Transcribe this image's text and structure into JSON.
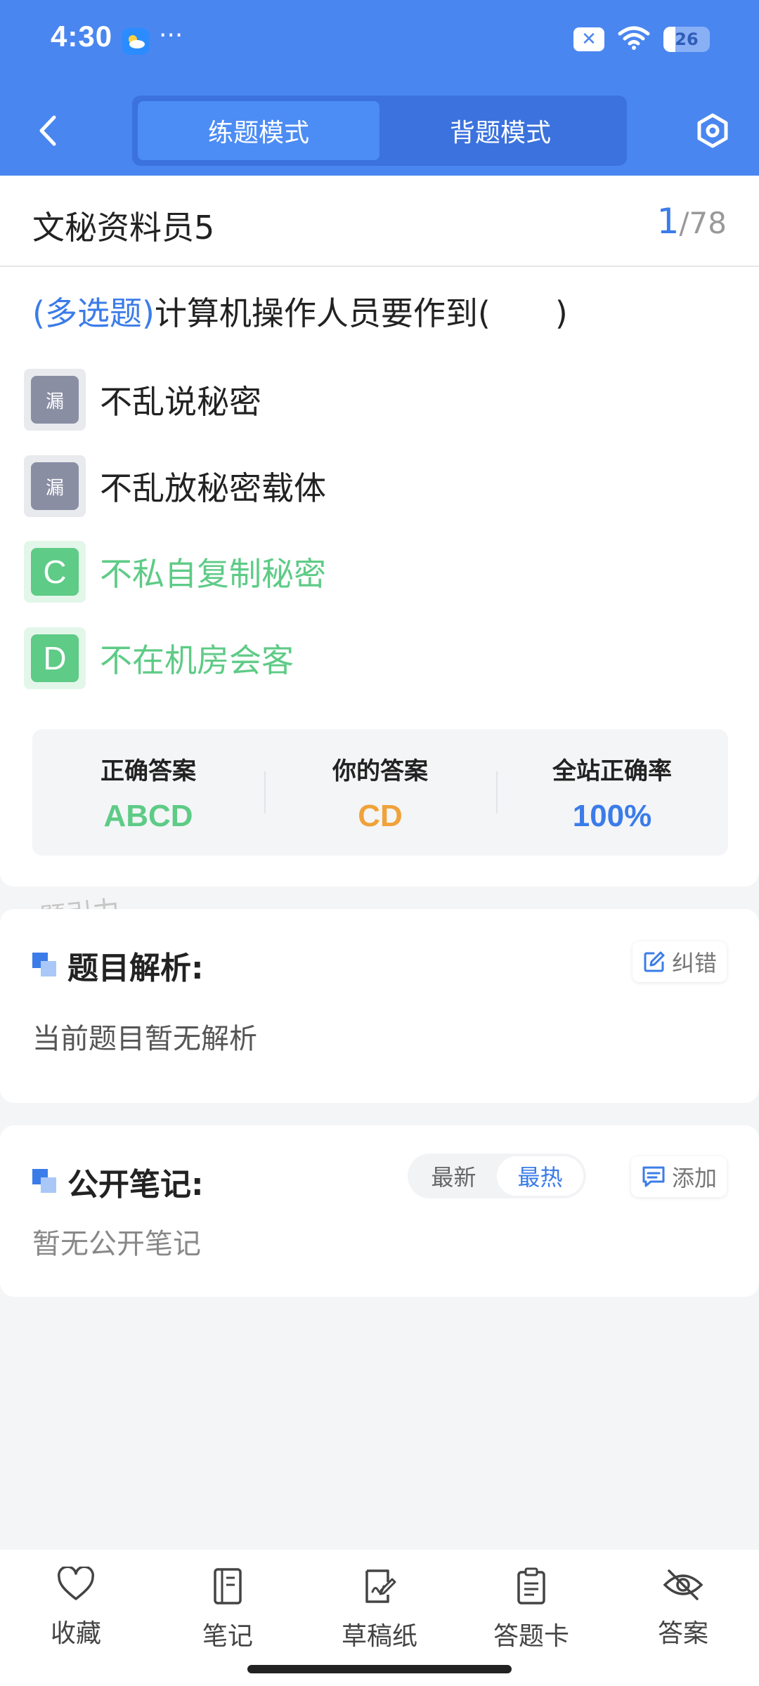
{
  "status": {
    "time": "4:30",
    "dots": "···",
    "battery": "26"
  },
  "nav": {
    "modes": [
      {
        "label": "练题模式",
        "active": true
      },
      {
        "label": "背题模式",
        "active": false
      }
    ]
  },
  "header": {
    "title": "文秘资料员5",
    "current": "1",
    "total": "/78"
  },
  "question": {
    "type": "(多选题)",
    "text": "计算机操作人员要作到(　　)"
  },
  "options": [
    {
      "badge": "漏",
      "text": "不乱说秘密",
      "state": "missed"
    },
    {
      "badge": "漏",
      "text": "不乱放秘密载体",
      "state": "missed"
    },
    {
      "badge": "C",
      "text": "不私自复制秘密",
      "state": "correct"
    },
    {
      "badge": "D",
      "text": "不在机房会客",
      "state": "correct"
    }
  ],
  "answers": {
    "correct_label": "正确答案",
    "correct_value": "ABCD",
    "yours_label": "你的答案",
    "yours_value": "CD",
    "rate_label": "全站正确率",
    "rate_value": "100%"
  },
  "watermark": "题引力",
  "analysis": {
    "title": "题目解析:",
    "correct_button": "纠错",
    "body": "当前题目暂无解析"
  },
  "notes": {
    "title": "公开笔记:",
    "sort_latest": "最新",
    "sort_hot": "最热",
    "sort_active": "最热",
    "add_button": "添加",
    "body": "暂无公开笔记"
  },
  "bottom_tabs": [
    {
      "label": "收藏",
      "icon": "heart-icon"
    },
    {
      "label": "笔记",
      "icon": "notebook-icon"
    },
    {
      "label": "草稿纸",
      "icon": "draft-icon"
    },
    {
      "label": "答题卡",
      "icon": "answer-card-icon"
    },
    {
      "label": "答案",
      "icon": "eye-off-icon"
    }
  ],
  "colors": {
    "primary": "#4a86f0",
    "accent": "#3b7ce9",
    "correct": "#5ecb86",
    "yours": "#f0a23a",
    "missed": "#8a8ea3"
  }
}
